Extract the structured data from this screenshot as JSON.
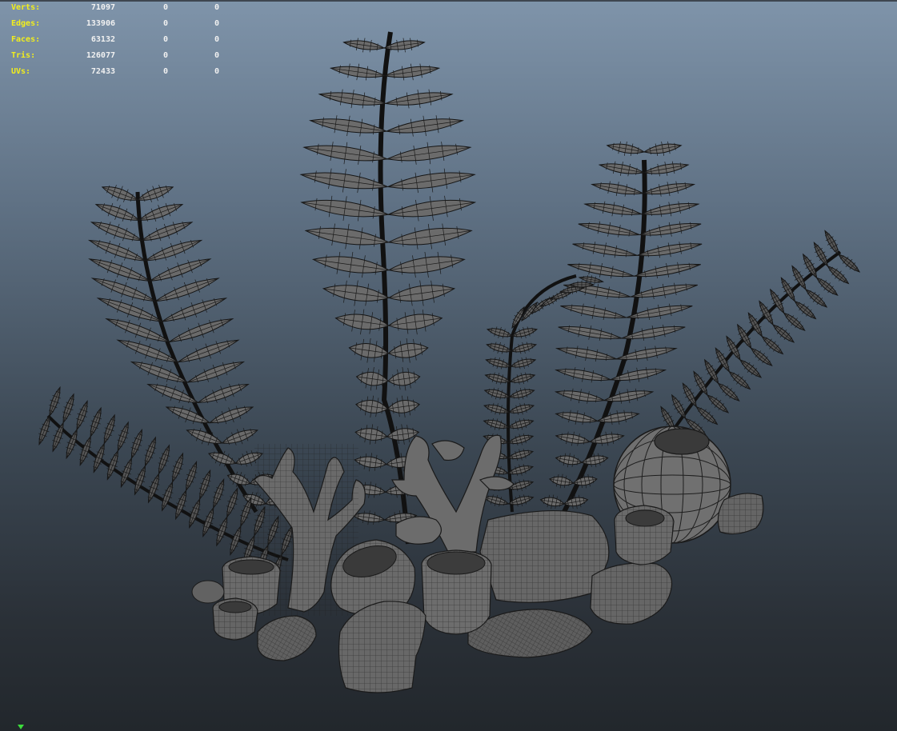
{
  "hud": {
    "rows": [
      {
        "label": "Verts:",
        "total": "71097",
        "selected": "0",
        "component": "0"
      },
      {
        "label": "Edges:",
        "total": "133906",
        "selected": "0",
        "component": "0"
      },
      {
        "label": "Faces:",
        "total": "63132",
        "selected": "0",
        "component": "0"
      },
      {
        "label": "Tris:",
        "total": "126077",
        "selected": "0",
        "component": "0"
      },
      {
        "label": "UVs:",
        "total": "72433",
        "selected": "0",
        "component": "0"
      }
    ]
  },
  "colors": {
    "hud_label": "#f2ee1c",
    "hud_value": "#f1f1f1",
    "mesh_fill": "#5e5e5e",
    "wire": "#1b1b1b",
    "leaf_fill": "#666666",
    "axis_green": "#3cdc3c"
  },
  "icons": {
    "axis": "axis-indicator-icon"
  }
}
